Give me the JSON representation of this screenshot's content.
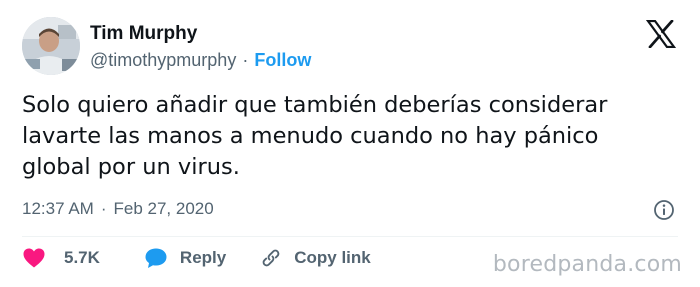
{
  "author": {
    "name": "Tim Murphy",
    "handle": "@timothypmurphy",
    "separator": "·",
    "follow_label": "Follow"
  },
  "tweet": {
    "lines": [
      "Solo quiero añadir que también deberías considerar",
      "lavarte las manos a menudo cuando no hay pánico",
      "global por un virus."
    ],
    "time": "12:37 AM",
    "separator": "·",
    "date": "Feb 27, 2020"
  },
  "actions": {
    "likes": "5.7K",
    "reply_label": "Reply",
    "copy_link_label": "Copy link"
  },
  "watermark": "boredpanda.com",
  "colors": {
    "follow": "#1d9bf0",
    "heart": "#f91880",
    "reply_bubble": "#1d9bf0",
    "muted": "#536471"
  },
  "icons": {
    "brand": "x-logo-icon",
    "info": "info-icon",
    "like": "heart-icon",
    "reply": "reply-bubble-icon",
    "copy_link": "link-icon"
  }
}
